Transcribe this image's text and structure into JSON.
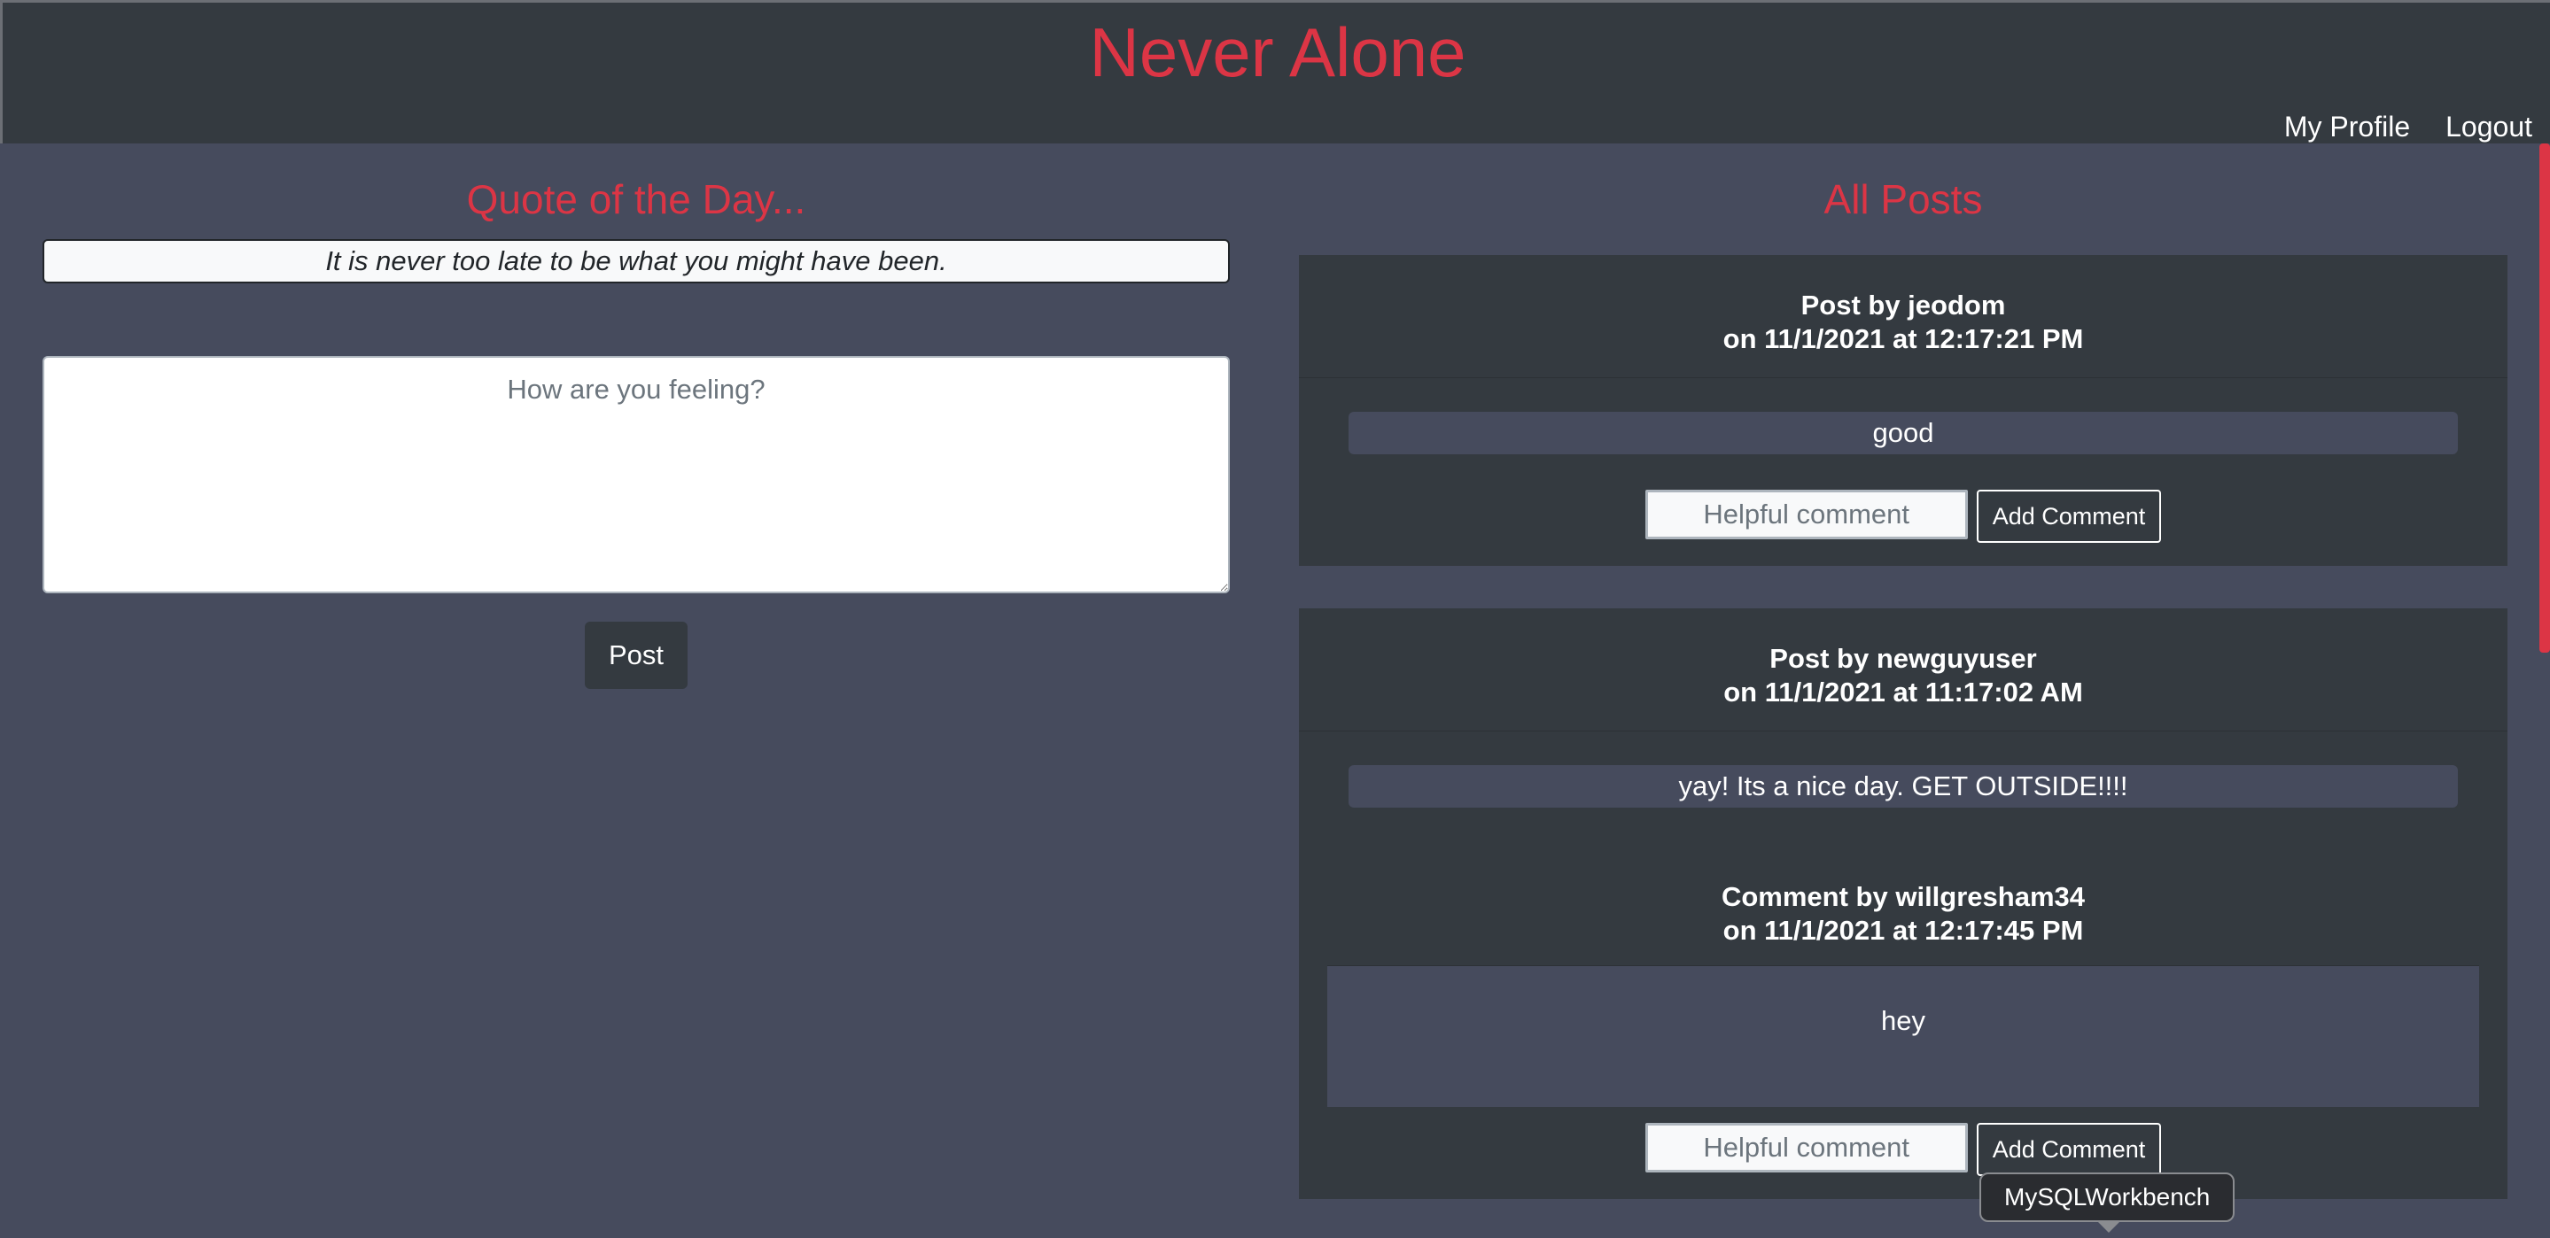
{
  "header": {
    "title": "Never Alone",
    "nav": {
      "profile": "My Profile",
      "logout": "Logout"
    }
  },
  "quote": {
    "title": "Quote of the Day...",
    "text": "It is never too late to be what you might have been."
  },
  "composer": {
    "placeholder": "How are you feeling?",
    "post_label": "Post"
  },
  "feed": {
    "title": "All Posts",
    "comment_placeholder": "Helpful comment",
    "add_comment_label": "Add Comment",
    "posts": [
      {
        "byline": "Post by jeodom",
        "date": "on 11/1/2021 at 12:17:21 PM",
        "content": "good"
      },
      {
        "byline": "Post by newguyuser",
        "date": "on 11/1/2021 at 11:17:02 AM",
        "content": "yay! Its a nice day. GET OUTSIDE!!!!",
        "comments": [
          {
            "byline": "Comment by willgresham34",
            "date": "on 11/1/2021 at 12:17:45 PM",
            "content": "hey"
          }
        ]
      }
    ]
  },
  "tooltip": {
    "text": "MySQLWorkbench"
  },
  "colors": {
    "accent": "#dc3545",
    "dark": "#343a40",
    "background": "#464b5d"
  }
}
